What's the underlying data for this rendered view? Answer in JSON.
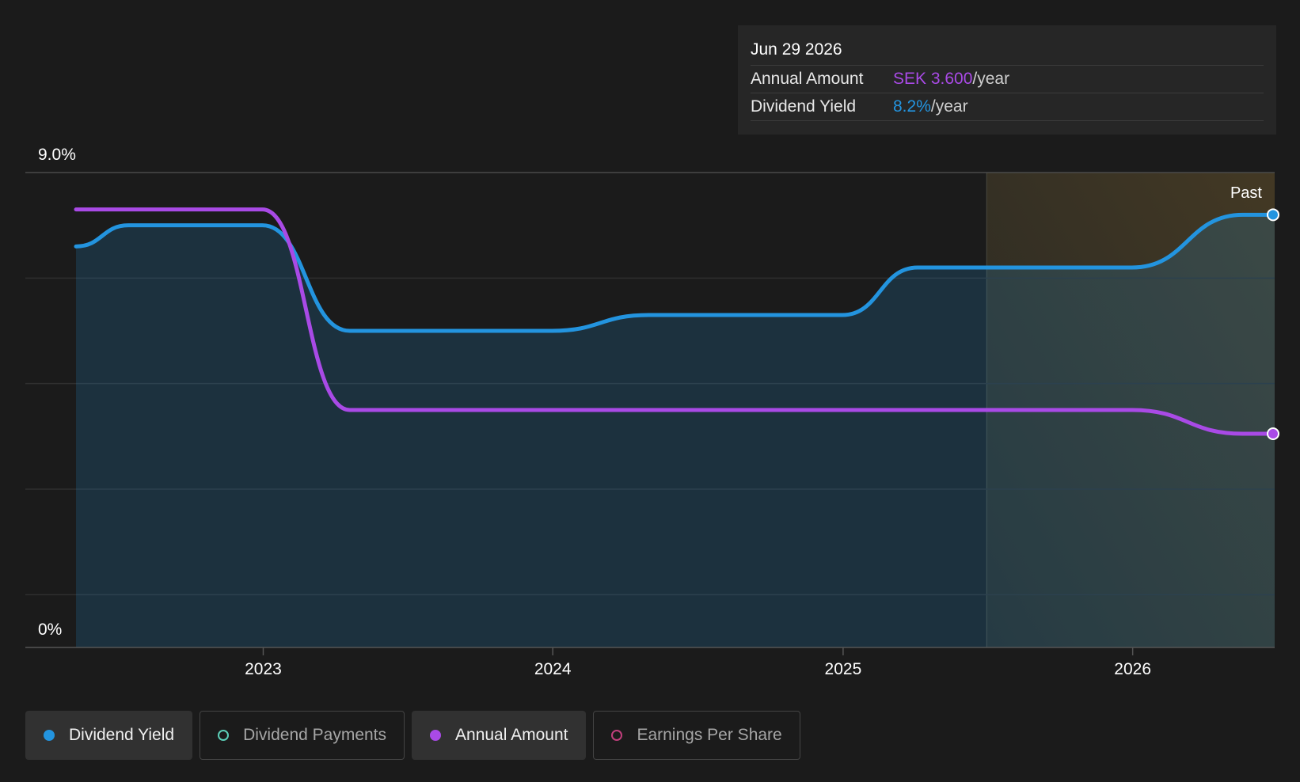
{
  "tooltip": {
    "date": "Jun 29 2026",
    "rows": [
      {
        "label": "Annual Amount",
        "value": "SEK 3.600",
        "suffix": "/year",
        "color": "#a94ae6"
      },
      {
        "label": "Dividend Yield",
        "value": "8.2%",
        "suffix": "/year",
        "color": "#2394df"
      }
    ]
  },
  "legend": [
    {
      "label": "Dividend Yield",
      "color": "#2394df",
      "active": true,
      "filled": true
    },
    {
      "label": "Dividend Payments",
      "color": "#5ccfb8",
      "active": false,
      "filled": false
    },
    {
      "label": "Annual Amount",
      "color": "#a94ae6",
      "active": true,
      "filled": true
    },
    {
      "label": "Earnings Per Share",
      "color": "#c13f7c",
      "active": false,
      "filled": false
    }
  ],
  "chart_data": {
    "type": "line",
    "y_tick_labels": [
      "9.0%",
      "0%"
    ],
    "ylim": [
      0,
      9.0
    ],
    "x_tick_labels": [
      "2023",
      "2024",
      "2025",
      "2026"
    ],
    "x_tick_dates": [
      "2023-01-01",
      "2024-01-01",
      "2025-01-01",
      "2026-01-01"
    ],
    "xlim": [
      "2022-05-10",
      "2026-06-29"
    ],
    "past_region_start": "2025-07-01",
    "past_label": "Past",
    "grid": true,
    "series": [
      {
        "name": "Dividend Yield",
        "color": "#2394df",
        "fill": true,
        "points": [
          [
            "2022-05-10",
            7.6
          ],
          [
            "2022-07-15",
            8.0
          ],
          [
            "2022-12-31",
            8.0
          ],
          [
            "2023-04-20",
            6.0
          ],
          [
            "2023-12-31",
            6.0
          ],
          [
            "2024-05-01",
            6.3
          ],
          [
            "2024-12-31",
            6.3
          ],
          [
            "2025-04-05",
            7.2
          ],
          [
            "2025-12-31",
            7.2
          ],
          [
            "2026-05-20",
            8.2
          ],
          [
            "2026-06-29",
            8.2
          ]
        ]
      },
      {
        "name": "Annual Amount",
        "color": "#a94ae6",
        "fill": false,
        "points": [
          [
            "2022-05-10",
            8.3
          ],
          [
            "2022-12-31",
            8.3
          ],
          [
            "2023-04-20",
            4.5
          ],
          [
            "2025-12-31",
            4.5
          ],
          [
            "2026-05-20",
            4.05
          ],
          [
            "2026-06-29",
            4.05
          ]
        ]
      }
    ]
  }
}
